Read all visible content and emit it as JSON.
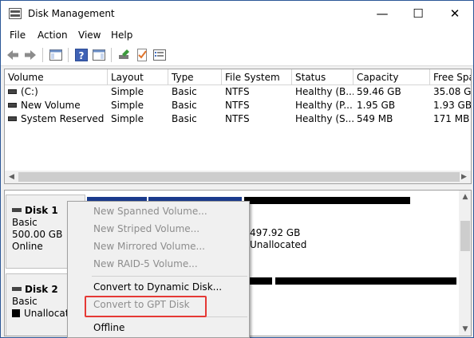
{
  "window": {
    "title": "Disk Management",
    "icon": "disk-management-icon",
    "controls": {
      "minimize": "—",
      "maximize": "☐",
      "close": "✕"
    }
  },
  "menu": [
    "File",
    "Action",
    "View",
    "Help"
  ],
  "toolbar": {
    "icons": [
      "back-arrow-icon",
      "forward-arrow-icon",
      "console-tree-icon",
      "help-icon",
      "properties-icon",
      "rescan-icon",
      "check-icon",
      "list-icon"
    ]
  },
  "volumes": {
    "columns": [
      "Volume",
      "Layout",
      "Type",
      "File System",
      "Status",
      "Capacity",
      "Free Spa..."
    ],
    "rows": [
      [
        "(C:)",
        "Simple",
        "Basic",
        "NTFS",
        "Healthy (B...",
        "59.46 GB",
        "35.08 GB"
      ],
      [
        "New Volume",
        "Simple",
        "Basic",
        "NTFS",
        "Healthy (P...",
        "1.95 GB",
        "1.93 GB"
      ],
      [
        "System Reserved",
        "Simple",
        "Basic",
        "NTFS",
        "Healthy (S...",
        "549 MB",
        "171 MB"
      ]
    ]
  },
  "disks": [
    {
      "name": "Disk 1",
      "type": "Basic",
      "size": "500.00 GB",
      "status": "Online",
      "partition": {
        "size": "497.92 GB",
        "label": "Unallocated"
      }
    },
    {
      "name": "Disk 2",
      "type": "Basic",
      "status": "Unallocate"
    }
  ],
  "context_menu": {
    "items": [
      {
        "label": "New Spanned Volume...",
        "enabled": false
      },
      {
        "label": "New Striped Volume...",
        "enabled": false
      },
      {
        "label": "New Mirrored Volume...",
        "enabled": false
      },
      {
        "label": "New RAID-5 Volume...",
        "enabled": false
      },
      {
        "label": "Convert to Dynamic Disk...",
        "enabled": true
      },
      {
        "label": "Convert to GPT Disk",
        "enabled": false,
        "highlighted": true
      },
      {
        "label": "Offline",
        "enabled": true
      }
    ]
  },
  "colors": {
    "primary_partition": "#1a3a8c",
    "unallocated": "#000000",
    "highlight_box": "#e53935",
    "disabled_text": "#8d8d8d"
  }
}
